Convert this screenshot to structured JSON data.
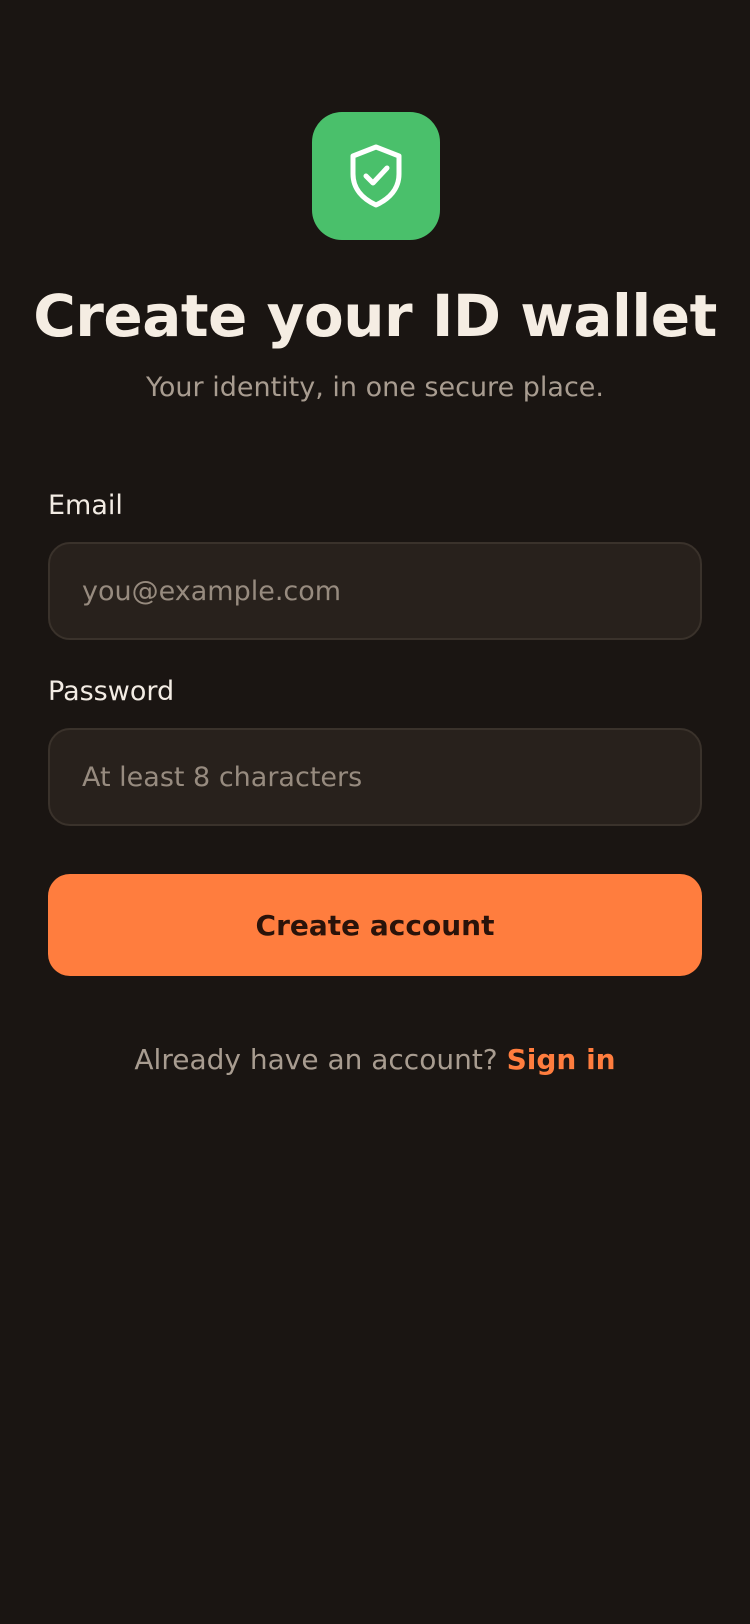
{
  "brand": {
    "icon": "shield-check-icon",
    "tile_color": "#4ac06b"
  },
  "header": {
    "title": "Create your ID wallet",
    "subtitle": "Your identity, in one secure place."
  },
  "form": {
    "email": {
      "label": "Email",
      "value": "",
      "placeholder": "you@example.com"
    },
    "password": {
      "label": "Password",
      "value": "",
      "placeholder": "At least 8 characters"
    },
    "submit_label": "Create account"
  },
  "footer": {
    "prompt": "Already have an account?",
    "link_label": "Sign in"
  },
  "colors": {
    "background": "#1a1512",
    "accent": "#ff7d3e",
    "brand_green": "#4ac06b"
  }
}
